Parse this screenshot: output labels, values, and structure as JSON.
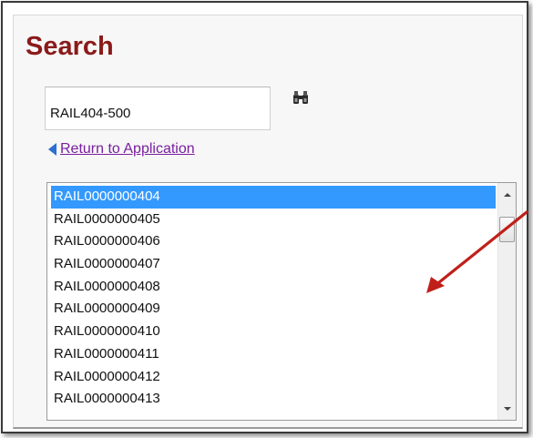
{
  "title": "Search",
  "search": {
    "value": "RAIL404-500",
    "button_icon": "binoculars-icon"
  },
  "return_link": {
    "label": "Return to Application",
    "icon": "left-triangle-icon"
  },
  "results": {
    "items": [
      "RAIL0000000404",
      "RAIL0000000405",
      "RAIL0000000406",
      "RAIL0000000407",
      "RAIL0000000408",
      "RAIL0000000409",
      "RAIL0000000410",
      "RAIL0000000411",
      "RAIL0000000412",
      "RAIL0000000413"
    ],
    "selected_index": 0
  },
  "annotation": {
    "arrow_color": "#c0201a"
  },
  "colors": {
    "title": "#8b1a1a",
    "selection": "#3399ff",
    "link": "#7a1f9e"
  }
}
